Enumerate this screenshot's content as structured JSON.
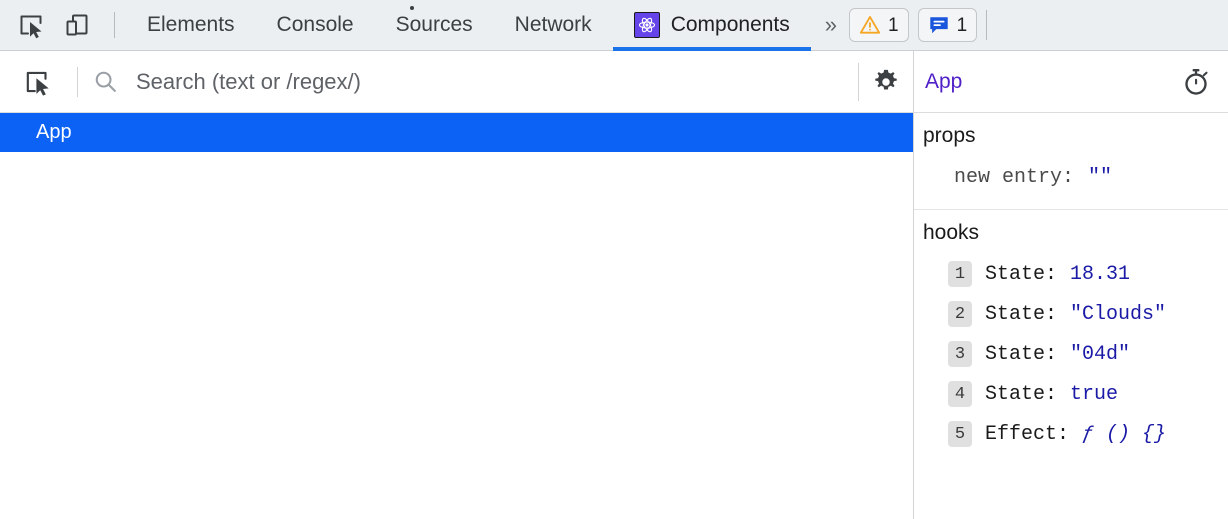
{
  "devtools": {
    "toolbar": {
      "inspect_icon": "inspect-cursor-icon",
      "device_toggle_icon": "device-toolbar-icon",
      "more_tabs_label": "»",
      "tabs": [
        {
          "label": "Elements",
          "active": false,
          "has_dot": false,
          "icon": null
        },
        {
          "label": "Console",
          "active": false,
          "has_dot": false,
          "icon": null
        },
        {
          "label": "Sources",
          "active": false,
          "has_dot": true,
          "icon": null
        },
        {
          "label": "Network",
          "active": false,
          "has_dot": false,
          "icon": null
        },
        {
          "label": "Components",
          "active": true,
          "has_dot": false,
          "icon": "react-logo-icon"
        }
      ],
      "warnings": {
        "icon": "warning-triangle-icon",
        "count": "1",
        "color": "#f5a623"
      },
      "messages": {
        "icon": "message-bubble-icon",
        "count": "1",
        "color": "#1a56db"
      }
    },
    "components_panel": {
      "search": {
        "select_element_icon": "select-element-icon",
        "search_icon": "search-icon",
        "placeholder": "Search (text or /regex/)",
        "value": "",
        "settings_icon": "gear-icon"
      },
      "tree": {
        "items": [
          {
            "label": "App",
            "selected": true,
            "depth": 0
          }
        ]
      },
      "inspector": {
        "header": {
          "title": "App",
          "timer_icon": "stopwatch-icon"
        },
        "sections": [
          {
            "title": "props",
            "type": "props",
            "rows": [
              {
                "key": "new entry:",
                "value": "\"\""
              }
            ]
          },
          {
            "title": "hooks",
            "type": "hooks",
            "rows": [
              {
                "index": "1",
                "label": "State:",
                "value": "18.31",
                "is_fn": false
              },
              {
                "index": "2",
                "label": "State:",
                "value": "\"Clouds\"",
                "is_fn": false
              },
              {
                "index": "3",
                "label": "State:",
                "value": "\"04d\"",
                "is_fn": false
              },
              {
                "index": "4",
                "label": "State:",
                "value": "true",
                "is_fn": false
              },
              {
                "index": "5",
                "label": "Effect:",
                "value": "ƒ () {}",
                "is_fn": true
              }
            ]
          }
        ]
      }
    },
    "colors": {
      "tabbar_bg": "#eceff1",
      "active_tab_underline": "#1a73e8",
      "tree_selection": "#0b62f5",
      "react_badge": "#6544e9",
      "inspector_title": "#5020c8",
      "value_blue": "#1a1aa6",
      "warning_orange": "#f5a623",
      "message_blue": "#1a56db"
    }
  }
}
